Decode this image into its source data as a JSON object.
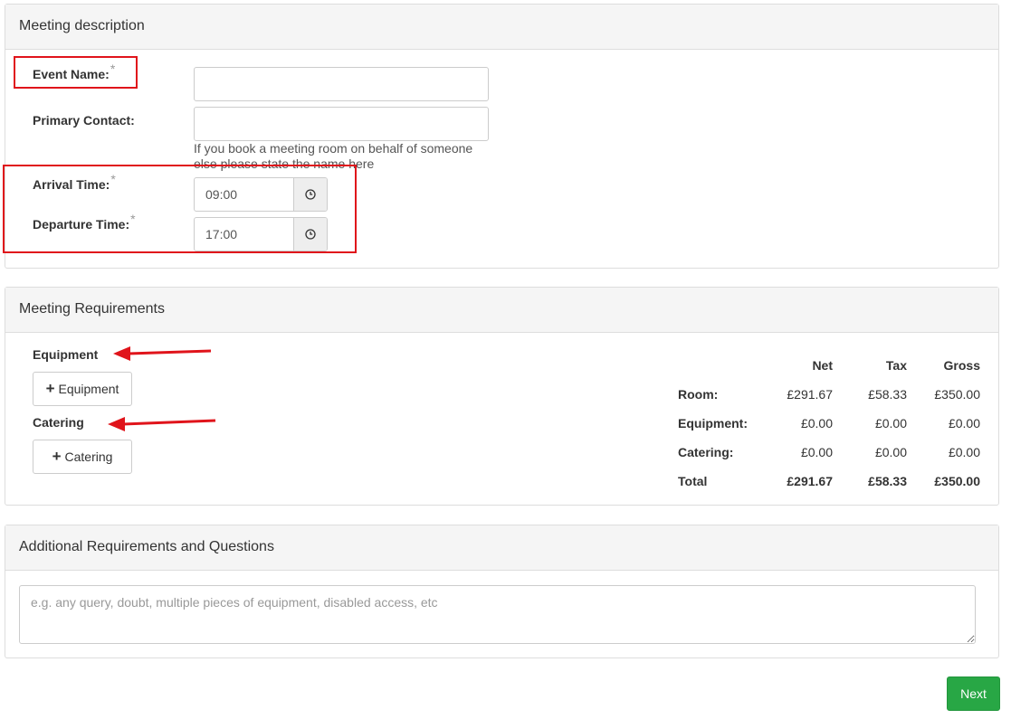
{
  "meeting_description": {
    "title": "Meeting description",
    "event_name": {
      "label": "Event Name:",
      "required_mark": "*",
      "value": ""
    },
    "primary_contact": {
      "label": "Primary Contact:",
      "value": "",
      "help_line1": "If you book a meeting room on behalf of someone",
      "help_line2": "else please state the name here"
    },
    "arrival_time": {
      "label": "Arrival Time:",
      "required_mark": "*",
      "value": "09:00",
      "icon": "clock-icon"
    },
    "departure_time": {
      "label": "Departure Time:",
      "required_mark": "*",
      "value": "17:00",
      "icon": "clock-icon"
    }
  },
  "meeting_requirements": {
    "title": "Meeting Requirements",
    "equipment": {
      "heading": "Equipment",
      "button_label": "Equipment"
    },
    "catering": {
      "heading": "Catering",
      "button_label": "Catering"
    },
    "summary": {
      "headers": [
        "",
        "Net",
        "Tax",
        "Gross"
      ],
      "rows": [
        {
          "label": "Room:",
          "net": "£291.67",
          "tax": "£58.33",
          "gross": "£350.00"
        },
        {
          "label": "Equipment:",
          "net": "£0.00",
          "tax": "£0.00",
          "gross": "£0.00"
        },
        {
          "label": "Catering:",
          "net": "£0.00",
          "tax": "£0.00",
          "gross": "£0.00"
        },
        {
          "label": "Total",
          "net": "£291.67",
          "tax": "£58.33",
          "gross": "£350.00"
        }
      ]
    }
  },
  "additional": {
    "title": "Additional Requirements and Questions",
    "placeholder": "e.g. any query, doubt, multiple pieces of equipment, disabled access, etc",
    "value": ""
  },
  "next_button": "Next",
  "colors": {
    "annotation_red": "#e0141b",
    "next_green": "#28a745",
    "panel_heading_bg": "#f5f5f5"
  }
}
